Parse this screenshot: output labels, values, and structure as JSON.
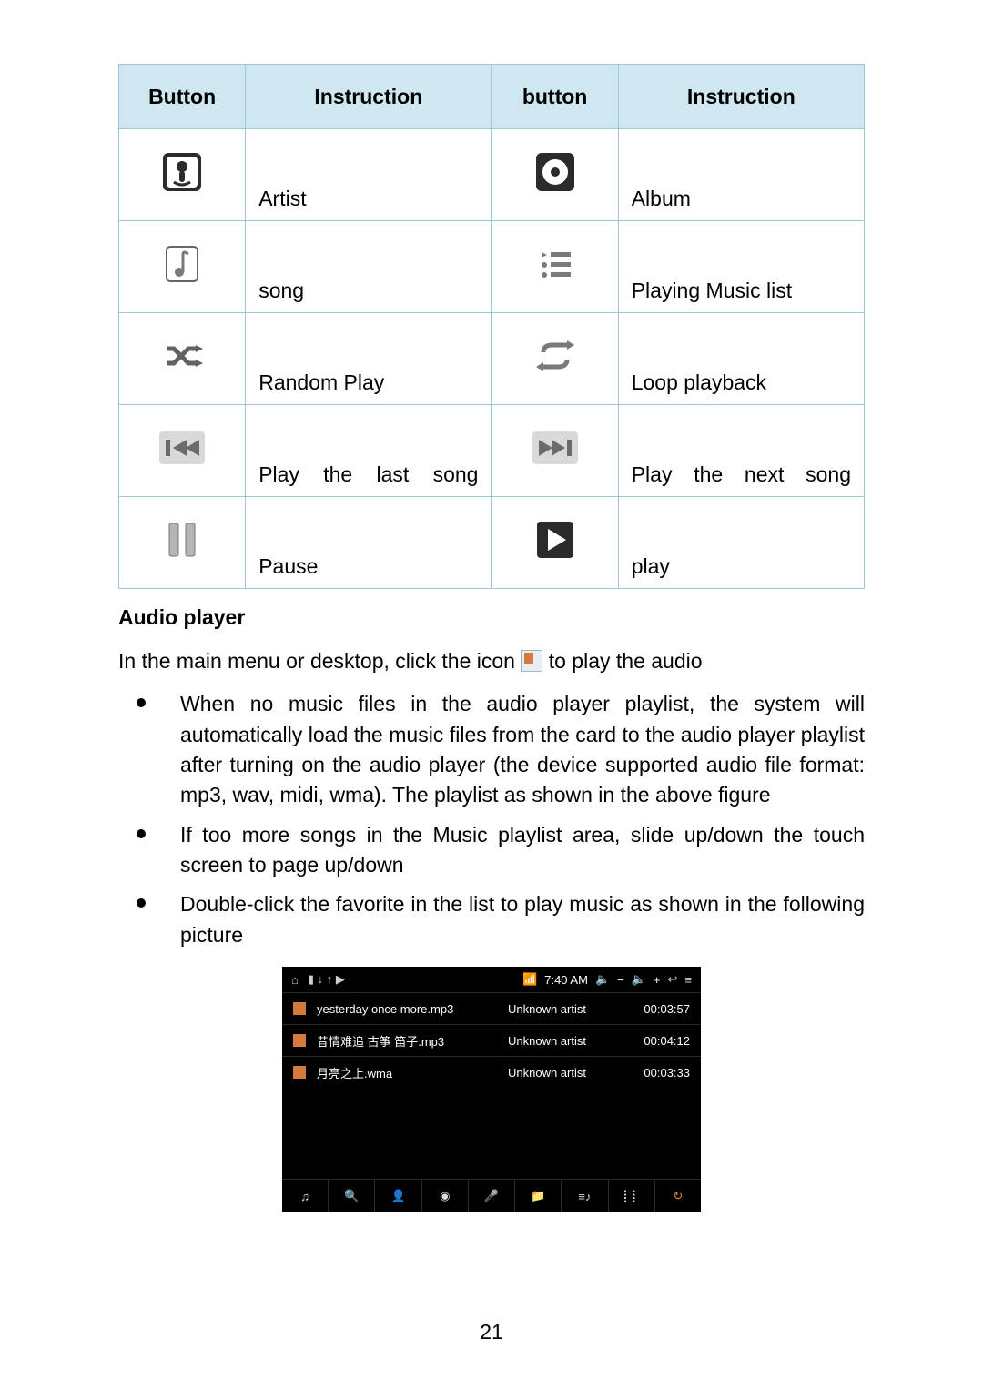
{
  "table": {
    "headers": [
      "Button",
      "Instruction",
      "button",
      "Instruction"
    ],
    "rows": [
      {
        "left_instruction": "Artist",
        "right_instruction": "Album"
      },
      {
        "left_instruction": "song",
        "right_instruction": "Playing Music list"
      },
      {
        "left_instruction": "Random Play",
        "right_instruction": "Loop playback"
      },
      {
        "left_instruction": "Play the last song",
        "right_instruction": "Play the next song"
      },
      {
        "left_instruction": "Pause",
        "right_instruction": "play"
      }
    ]
  },
  "section_title": "Audio player",
  "intro_before": "In the main menu or desktop, click the icon",
  "intro_after": "to play the audio",
  "bullets": [
    "When no music files in the audio player playlist, the system will automatically load the music files from the card to the audio player playlist after turning on the audio player (the device supported audio file format: mp3, wav, midi, wma). The playlist as shown in the above figure",
    "If too more songs in the Music playlist area, slide up/down the touch screen to page up/down",
    "Double-click the favorite in the list to play music as shown in the following picture"
  ],
  "screenshot": {
    "status": {
      "time": "7:40 AM",
      "vol_minus": "−",
      "vol_plus": "+"
    },
    "tracks": [
      {
        "title": "yesterday once more.mp3",
        "artist": "Unknown artist",
        "duration": "00:03:57"
      },
      {
        "title": "昔情难追 古筝 笛子.mp3",
        "artist": "Unknown artist",
        "duration": "00:04:12"
      },
      {
        "title": "月亮之上.wma",
        "artist": "Unknown artist",
        "duration": "00:03:33"
      }
    ]
  },
  "page_number": "21"
}
